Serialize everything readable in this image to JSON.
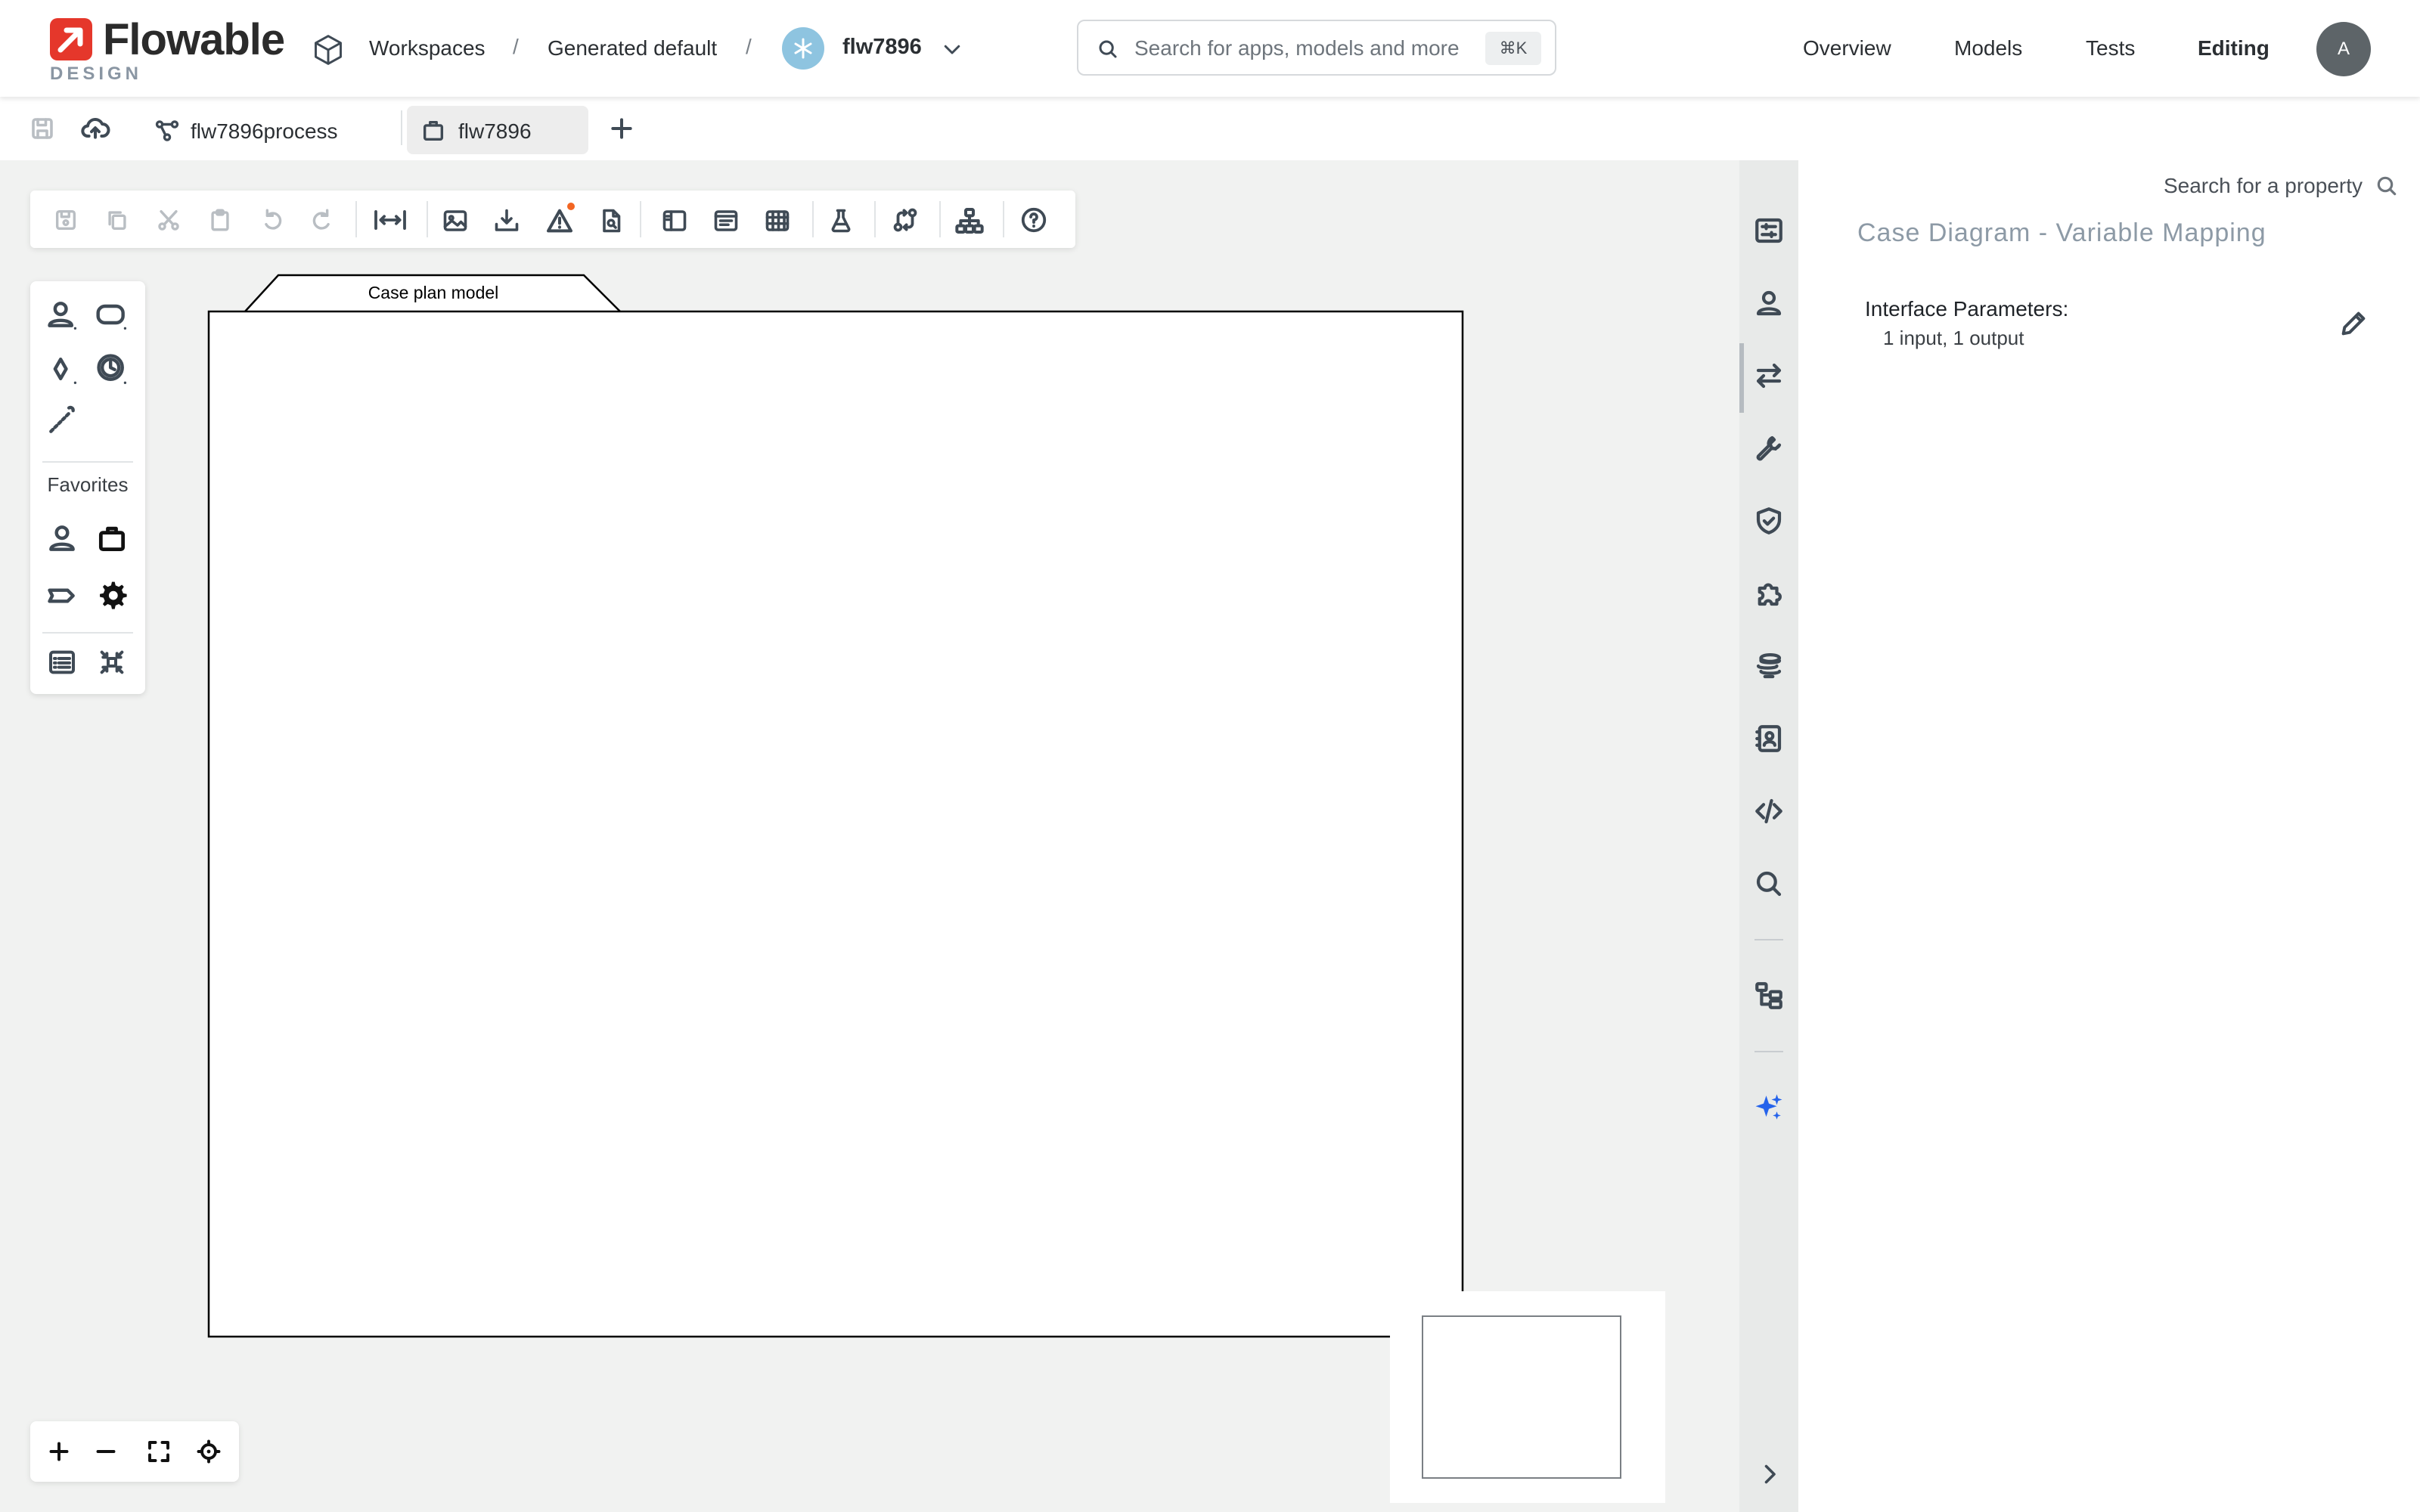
{
  "header": {
    "brand": "Flowable",
    "brand_sub": "DESIGN",
    "breadcrumb": {
      "workspaces": "Workspaces",
      "separator": "/",
      "workspace": "Generated default",
      "app": "flw7896"
    },
    "search": {
      "placeholder": "Search for apps, models and more",
      "shortcut": "⌘K"
    },
    "nav": [
      "Overview",
      "Models",
      "Tests",
      "Editing"
    ],
    "active_nav": "Editing",
    "avatar_initial": "A"
  },
  "tabs": [
    {
      "label": "flw7896process",
      "icon": "process-icon",
      "active": false
    },
    {
      "label": "flw7896",
      "icon": "case-icon",
      "active": true
    }
  ],
  "canvas": {
    "case_plan_label": "Case plan model",
    "palette_favorites_label": "Favorites"
  },
  "properties": {
    "search_label": "Search for a property",
    "title": "Case Diagram - Variable Mapping",
    "interface_label": "Interface Parameters:",
    "interface_value": "1 input, 1 output"
  },
  "colors": {
    "brand_red": "#e5372b",
    "app_badge": "#8ec4e0",
    "ai_blue": "#2563eb",
    "warning_dot": "#f26522"
  }
}
